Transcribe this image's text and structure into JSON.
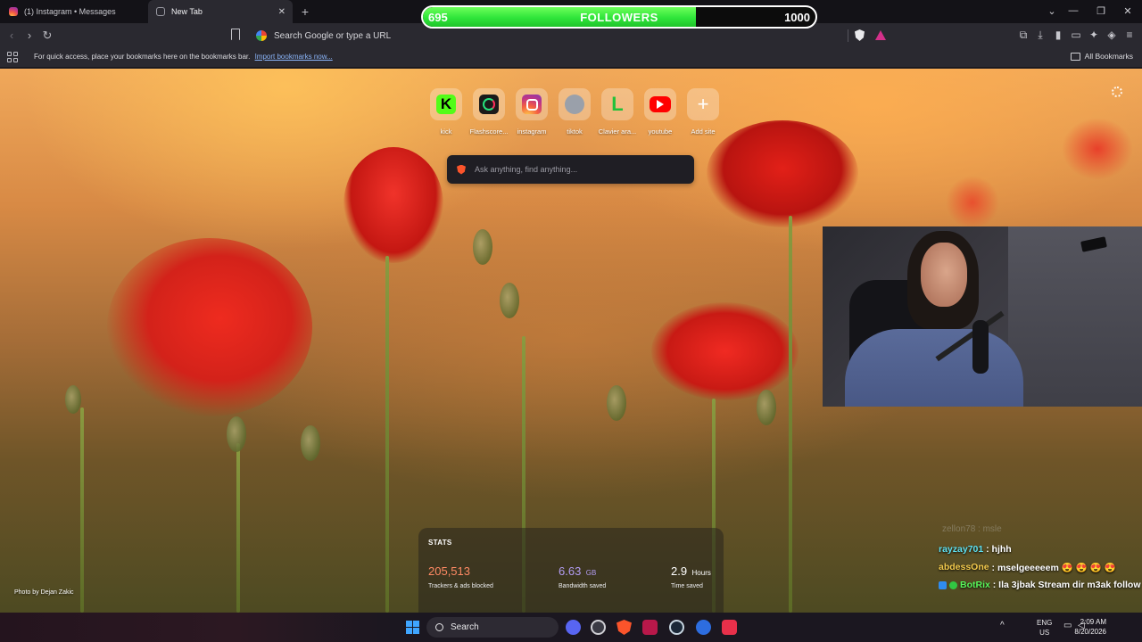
{
  "tabs": [
    {
      "title": "(1) Instagram • Messages",
      "favicon": "instagram-icon",
      "active": false
    },
    {
      "title": "New Tab",
      "favicon": "brave-shield-icon",
      "active": true
    }
  ],
  "new_tab_symbol": "+",
  "window_controls": {
    "list": "⌄",
    "minimize": "—",
    "restore": "❐",
    "close": "✕"
  },
  "followers_overlay": {
    "current": "695",
    "label": "FOLLOWERS",
    "goal": "1000",
    "progress": 0.695,
    "fill_color": "#2fe53a"
  },
  "toolbar": {
    "back": "‹",
    "forward": "›",
    "reload": "↻",
    "url_placeholder": "Search Google or type a URL"
  },
  "bookmarks_bar": {
    "hint": "For quick access, place your bookmarks here on the bookmarks bar.",
    "import_link": "Import bookmarks now...",
    "all_bookmarks": "All Bookmarks"
  },
  "top_sites": [
    {
      "name": "kick",
      "icon": "kick-icon",
      "glyph": "K"
    },
    {
      "name": "Flashscore...",
      "icon": "flashscore-icon",
      "glyph": ""
    },
    {
      "name": "instagram",
      "icon": "instagram-icon",
      "glyph": ""
    },
    {
      "name": "tiktok",
      "icon": "globe-icon",
      "glyph": ""
    },
    {
      "name": "Clavier ara...",
      "icon": "clavier-icon",
      "glyph": "L"
    },
    {
      "name": "youtube",
      "icon": "youtube-icon",
      "glyph": ""
    },
    {
      "name": "Add site",
      "icon": "plus-icon",
      "glyph": "+"
    }
  ],
  "search_box": {
    "placeholder": "Ask anything, find anything..."
  },
  "stats": {
    "heading": "STATS",
    "trackers": {
      "value": "205,513",
      "label": "Trackers & ads blocked"
    },
    "bandwidth": {
      "value": "6.63",
      "unit": "GB",
      "label": "Bandwidth saved"
    },
    "time": {
      "value": "2.9",
      "unit": "Hours",
      "label": "Time saved"
    }
  },
  "photo_credit": "Photo by Dejan Zakic",
  "chat": {
    "ghost_line": "zellon78 : msle",
    "messages": [
      {
        "user": "rayzay701",
        "text": ": hjhh"
      },
      {
        "user": "abdessOne",
        "text": ": mselgeeeeem 😍 😍 😍 😍"
      },
      {
        "user": "BotRix",
        "text": ": Ila 3jbak Stream dir m3ak follow"
      }
    ]
  },
  "taskbar": {
    "search": "Search",
    "lang_top": "ENG",
    "lang_bottom": "US",
    "time": "2:09 AM",
    "date": "8/20/2026",
    "tray_arrow": "^"
  }
}
